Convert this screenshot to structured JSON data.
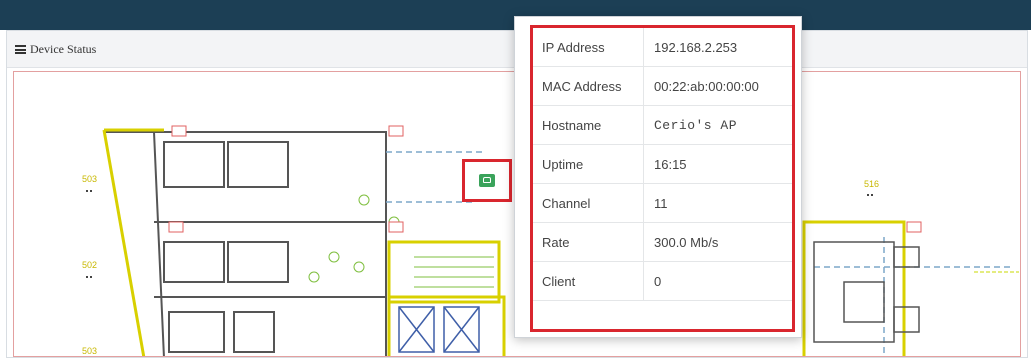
{
  "panel": {
    "title": "Device Status"
  },
  "map": {
    "room_labels": [
      "503",
      "502",
      "503",
      "516"
    ]
  },
  "ap_marker": {
    "icon": "router-icon",
    "color": "#3aa35b",
    "highlight": "#d9262e"
  },
  "device_info": {
    "rows": [
      {
        "label": "IP Address",
        "value": "192.168.2.253"
      },
      {
        "label": "MAC Address",
        "value": "00:22:ab:00:00:00"
      },
      {
        "label": "Hostname",
        "value": "Cerio's AP"
      },
      {
        "label": "Uptime",
        "value": "16:15"
      },
      {
        "label": "Channel",
        "value": "11"
      },
      {
        "label": "Rate",
        "value": "300.0 Mb/s"
      },
      {
        "label": "Client",
        "value": "0"
      }
    ]
  }
}
